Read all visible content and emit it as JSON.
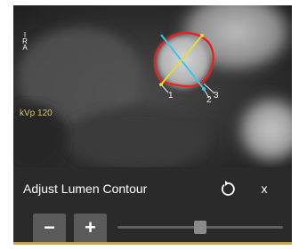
{
  "viewer": {
    "orientation_letters": [
      "I",
      "R",
      "A"
    ],
    "kvp_label": "kVp 120",
    "point_labels": [
      "1",
      "2",
      "3"
    ],
    "colors": {
      "contour": "#e8231f",
      "axis_major": "#38c8e8",
      "axis_minor": "#e8d83a",
      "overlay_text": "#d9c05a"
    }
  },
  "panel": {
    "title": "Adjust Lumen Contour",
    "reset_icon": "rotate-ccw-icon",
    "close_label": "x",
    "minus_label": "−",
    "plus_label": "+",
    "slider_level_percent": 50
  }
}
